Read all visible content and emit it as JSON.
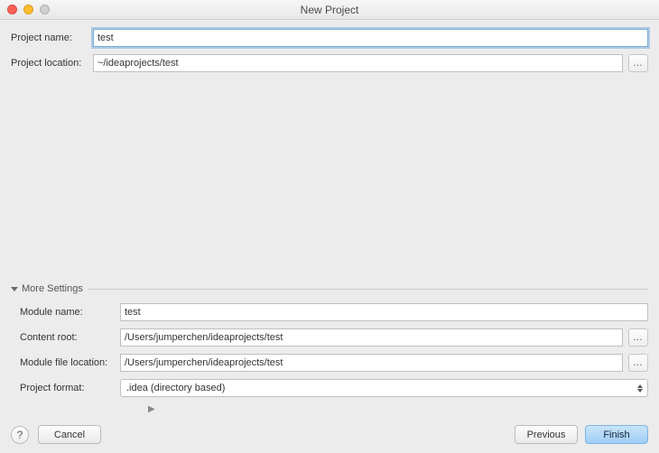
{
  "window": {
    "title": "New Project"
  },
  "form": {
    "projectName": {
      "label": "Project name:",
      "value": "test"
    },
    "projectLocation": {
      "label": "Project location:",
      "value": "~/ideaprojects/test"
    }
  },
  "moreSettings": {
    "title": "More Settings",
    "moduleName": {
      "label": "Module name:",
      "value": "test"
    },
    "contentRoot": {
      "label": "Content root:",
      "value": "/Users/jumperchen/ideaprojects/test"
    },
    "moduleFileLocation": {
      "label": "Module file location:",
      "value": "/Users/jumperchen/ideaprojects/test"
    },
    "projectFormat": {
      "label": "Project format:",
      "value": ".idea (directory based)"
    }
  },
  "buttons": {
    "help": "?",
    "cancel": "Cancel",
    "previous": "Previous",
    "finish": "Finish",
    "browse": "…"
  }
}
